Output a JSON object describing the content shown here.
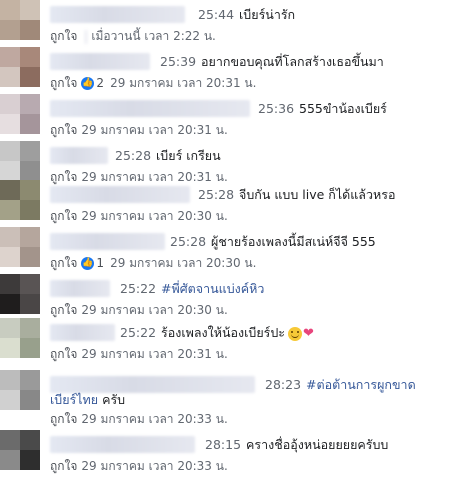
{
  "like_label": "ถูกใจ",
  "comments": [
    {
      "timestamp": "25:44",
      "text": "เบียร์น่ารัก",
      "time": "เมื่อวานนี้ เวลา 2:22 น.",
      "avatar_colors": [
        "#c4b3a3",
        "#cfc2b6",
        "#b3a090",
        "#a08979"
      ]
    },
    {
      "timestamp": "25:39",
      "text": "อยากขอบคุณที่โลกสร้างเธอขึ้นมา",
      "reaction_count": "2",
      "time": "29 มกราคม เวลา 20:31 น.",
      "avatar_colors": [
        "#bfa8a0",
        "#a8887a",
        "#d3c6bf",
        "#8c6c5f"
      ]
    },
    {
      "timestamp": "25:36",
      "text": "555ขำน้องเบียร์",
      "time": "29 มกราคม เวลา 20:31 น.",
      "avatar_colors": [
        "#d9cfd2",
        "#b8aab0",
        "#e6dee0",
        "#a5959b"
      ]
    },
    {
      "timestamp": "25:28",
      "text": "เบียร์ เกรียน",
      "time": "29 มกราคม เวลา 20:31 น.",
      "avatar_colors": [
        "#c7c7c7",
        "#9e9e9e",
        "#d6d6d6",
        "#8f8f8f"
      ]
    },
    {
      "timestamp": "25:28",
      "text": "จีบกัน แบบ live ก็ได้แล้วหรอ",
      "time": "29 มกราคม เวลา 20:30 น.",
      "avatar_colors": [
        "#6e6a58",
        "#8c8a70",
        "#a3a188",
        "#7c7a62"
      ]
    },
    {
      "timestamp": "25:28",
      "text": "ผู้ชายร้องเพลงนี้มีสเน่ห์จีจี 555",
      "reaction_count": "1",
      "time": "29 มกราคม เวลา 20:30 น.",
      "avatar_colors": [
        "#cbbfb8",
        "#b5a69d",
        "#ddd3cd",
        "#a3948b"
      ]
    },
    {
      "timestamp": "25:22",
      "hashtag": "#พี่ศัตจานแบ่งค์หิว",
      "time": "29 มกราคม เวลา 20:30 น.",
      "avatar_colors": [
        "#3d3a3a",
        "#595454",
        "#1f1d1d",
        "#4a4646"
      ]
    },
    {
      "timestamp": "25:22",
      "text": "ร้องเพลงให้น้องเบียร์ปะ",
      "emoji": [
        "smile-emoji",
        "heart-emoji"
      ],
      "time": "29 มกราคม เวลา 20:31 น.",
      "avatar_colors": [
        "#c8ccc0",
        "#a9ae9e",
        "#dadecf",
        "#98a08c"
      ]
    },
    {
      "timestamp": "28:23",
      "hashtag": "#ต่อต้านการผูกขาด",
      "reply_tag": "เบียร์ไทย",
      "reply_text": "ครับ",
      "time": "29 มกราคม เวลา 20:33 น.",
      "avatar_colors": [
        "#bcbcbc",
        "#9a9a9a",
        "#d0d0d0",
        "#888888"
      ]
    },
    {
      "timestamp": "28:15",
      "text": "ครางชื่ออุ้งหน่อยยยยครับบ",
      "time": "29 มกราคม เวลา 20:33 น.",
      "avatar_colors": [
        "#6b6b6b",
        "#4a4a4a",
        "#8a8a8a",
        "#2e2e2e"
      ]
    }
  ],
  "colors": {
    "timestamp": "#616770",
    "hashtag": "#365899",
    "reaction": "#1877f2"
  }
}
